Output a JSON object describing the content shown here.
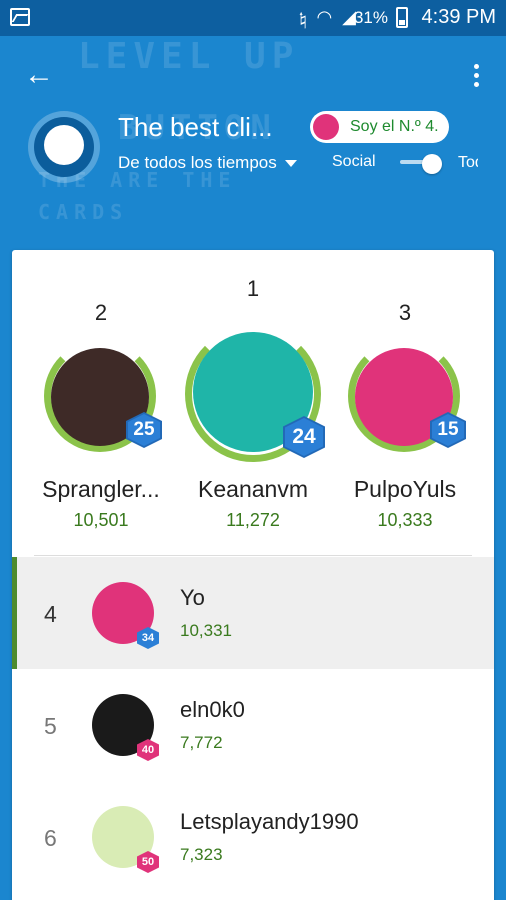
{
  "status_bar": {
    "battery_pct": "31%",
    "time": "4:39 PM",
    "icons": [
      "gallery-icon",
      "mute-icon",
      "wifi-icon",
      "signal-icon",
      "battery-icon"
    ]
  },
  "header": {
    "title": "The best cli...",
    "rank_pill": "Soy el N.º 4.",
    "filter_label": "De todos los tiempos",
    "social_label": "Social",
    "todos_label": "Todos",
    "background_pattern": [
      "LEVEL UP",
      "BUTTON",
      "THE ARE THE CARDS"
    ]
  },
  "podium": [
    {
      "rank": "2",
      "name": "Sprangler...",
      "points": "10,501",
      "level": "25",
      "avatar_color": "#3e2a27"
    },
    {
      "rank": "1",
      "name": "Keananvm",
      "points": "11,272",
      "level": "24",
      "avatar_color": "#1fb5a8"
    },
    {
      "rank": "3",
      "name": "PulpoYuls",
      "points": "10,333",
      "level": "15",
      "avatar_color": "#e0337a"
    }
  ],
  "list": [
    {
      "rank": "4",
      "name": "Yo",
      "points": "10,331",
      "level": "34",
      "avatar_color": "#e0337a",
      "badge_color": "#2b7fd6",
      "is_me": true
    },
    {
      "rank": "5",
      "name": "eln0k0",
      "points": "7,772",
      "level": "40",
      "avatar_color": "#1a1a1a",
      "badge_color": "#e0337a",
      "is_me": false
    },
    {
      "rank": "6",
      "name": "Letsplayandy1990",
      "points": "7,323",
      "level": "50",
      "avatar_color": "#d9ecb5",
      "badge_color": "#e0337a",
      "is_me": false
    }
  ],
  "colors": {
    "accent": "#1b86cf",
    "points_green": "#3a7a1e",
    "me_marker": "#4e8b2e"
  }
}
